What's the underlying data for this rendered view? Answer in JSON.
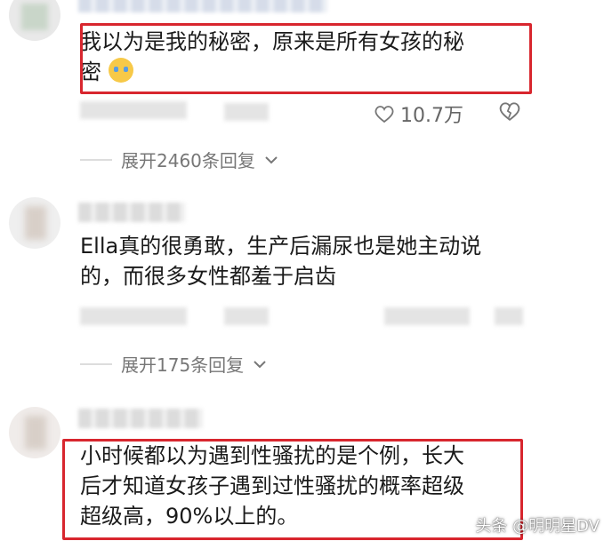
{
  "comments": [
    {
      "text_line1": "我以为是我的秘密，原来是所有女孩的秘",
      "text_line2": "密",
      "likes": "10.7万",
      "expand_label": "展开2460条回复"
    },
    {
      "text_line1": "Ella真的很勇敢，生产后漏尿也是她主动说",
      "text_line2": "的，而很多女性都羞于启齿",
      "expand_label": "展开175条回复"
    },
    {
      "text_line1": "小时候都以为遇到性骚扰的是个例，长大",
      "text_line2": "后才知道女孩子遇到过性骚扰的概率超级",
      "text_line3": "超级高，90%以上的。"
    }
  ],
  "watermark": "头条 @明明星DV",
  "colors": {
    "highlight": "#d8262e",
    "meta_text": "#777777"
  },
  "icons": [
    "heart-icon",
    "broken-heart-icon",
    "chevron-down-icon",
    "crying-emoji-icon"
  ]
}
